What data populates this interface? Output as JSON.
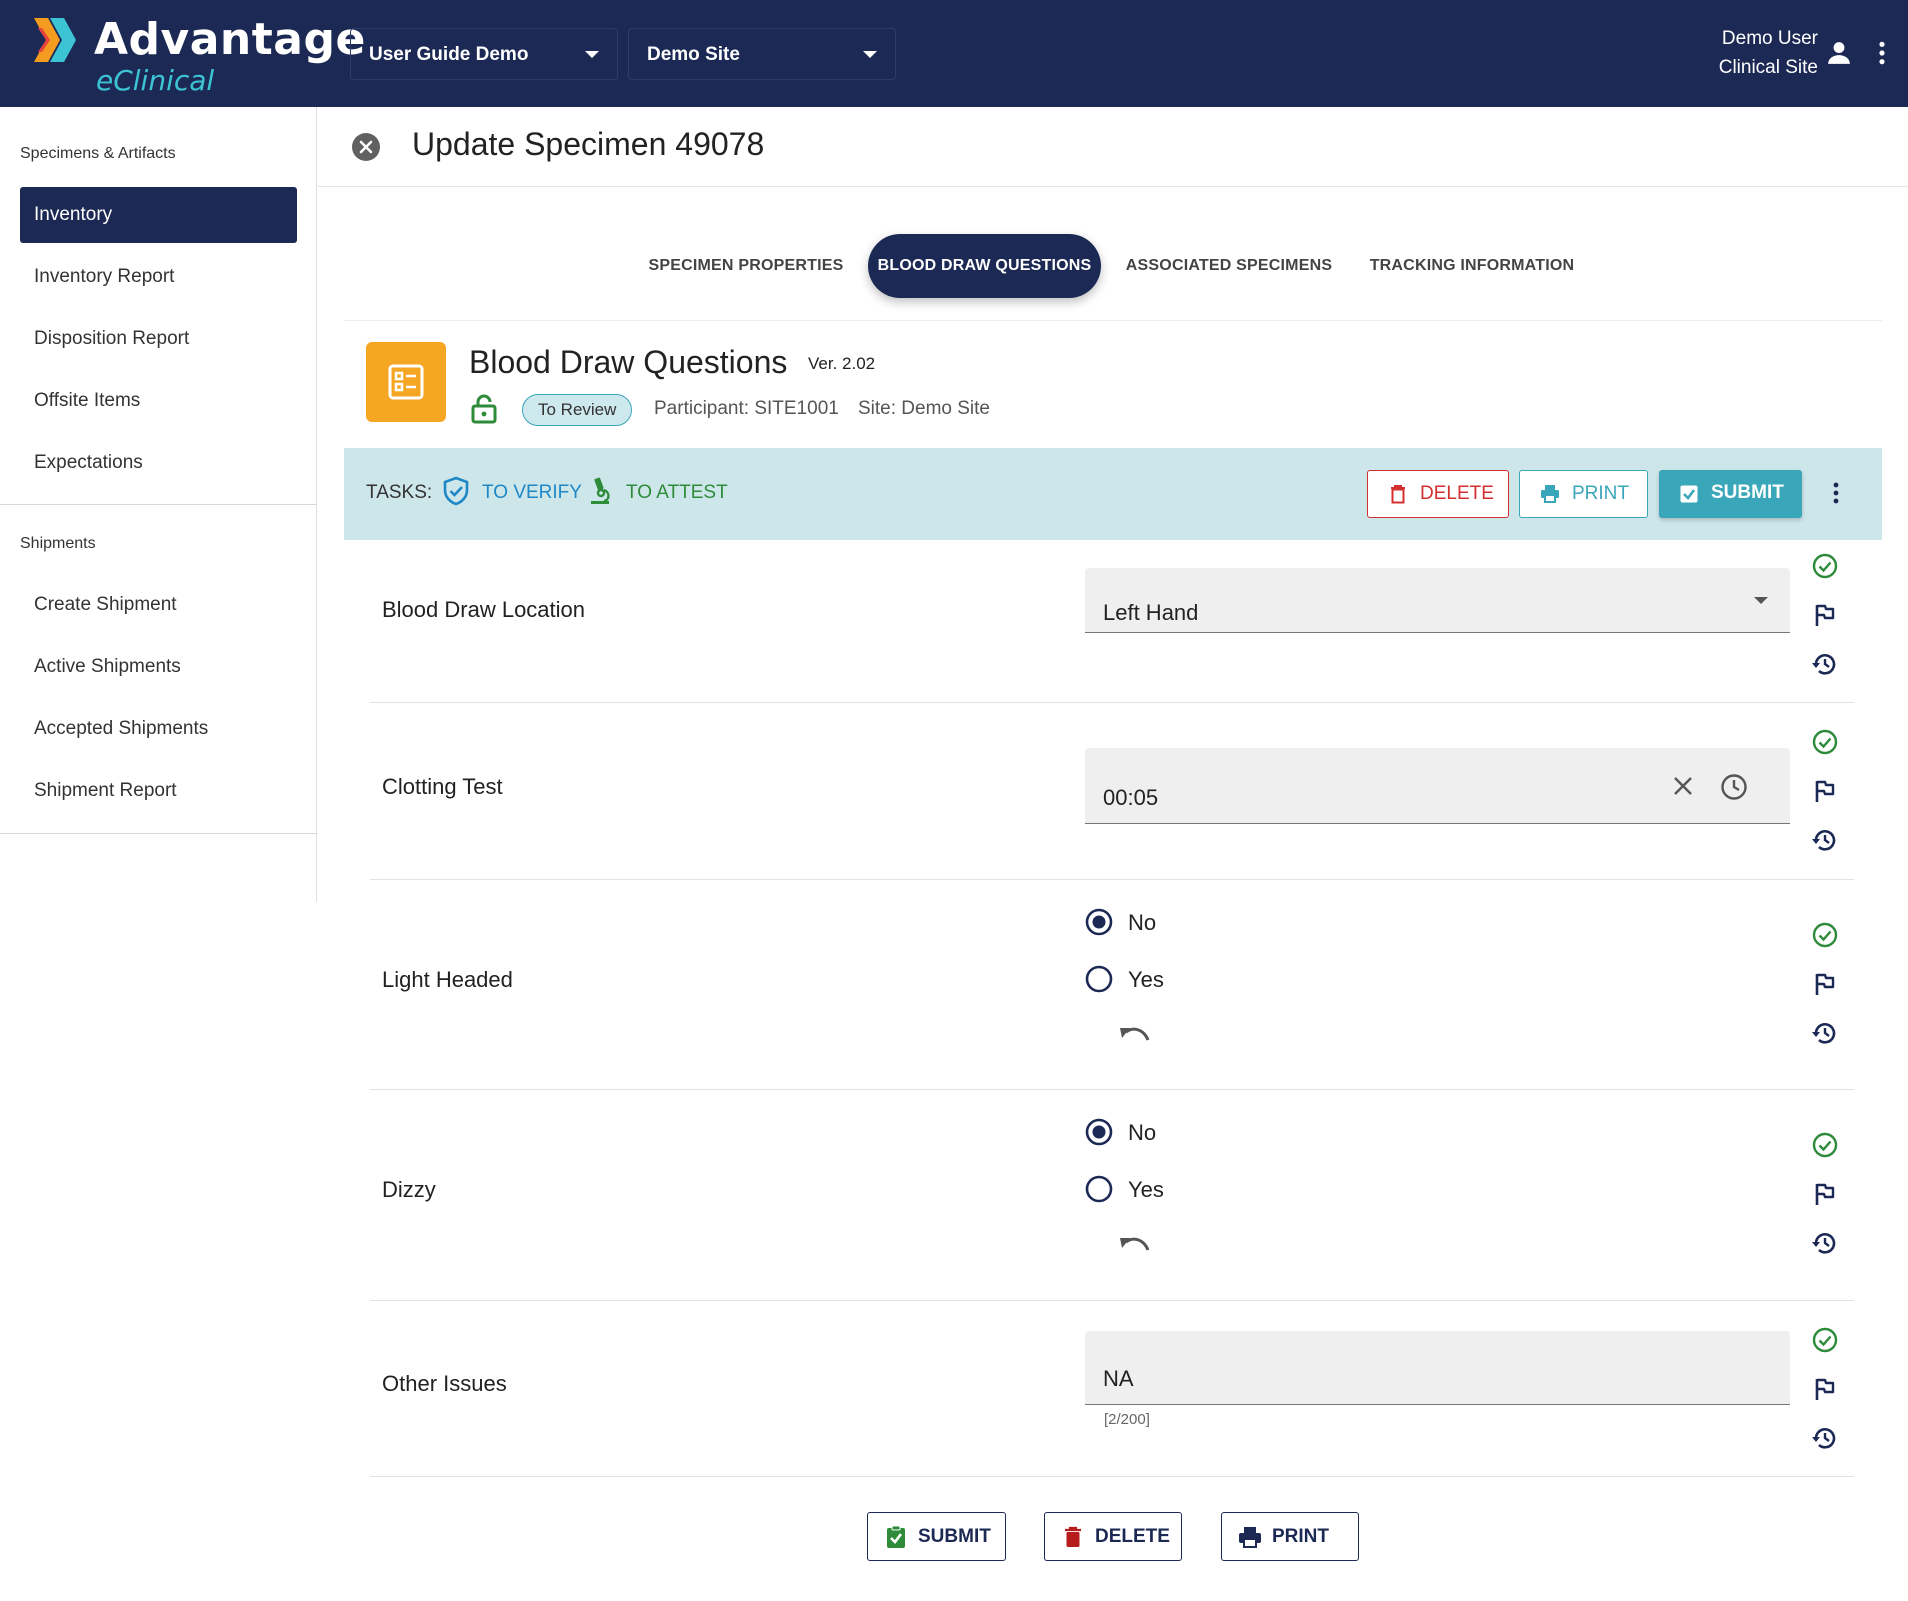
{
  "header": {
    "logo_main": "Advantage",
    "logo_sub": "eClinical",
    "study_select": "User Guide Demo",
    "site_select": "Demo Site",
    "user_name": "Demo User",
    "user_role": "Clinical Site"
  },
  "sidebar": {
    "section1": "Specimens & Artifacts",
    "items1": [
      "Inventory",
      "Inventory Report",
      "Disposition Report",
      "Offsite Items",
      "Expectations"
    ],
    "section2": "Shipments",
    "items2": [
      "Create Shipment",
      "Active Shipments",
      "Accepted Shipments",
      "Shipment Report"
    ],
    "active_item": "Inventory"
  },
  "page": {
    "title": "Update Specimen 49078"
  },
  "tabs": [
    "SPECIMEN PROPERTIES",
    "BLOOD DRAW QUESTIONS",
    "ASSOCIATED SPECIMENS",
    "TRACKING INFORMATION"
  ],
  "active_tab": "BLOOD DRAW QUESTIONS",
  "form": {
    "title": "Blood Draw Questions",
    "version": "Ver. 2.02",
    "status": "To Review",
    "participant": "Participant: SITE1001",
    "site": "Site: Demo Site"
  },
  "taskbar": {
    "label": "TASKS:",
    "verify": "TO VERIFY",
    "attest": "TO ATTEST",
    "delete": "DELETE",
    "print": "PRINT",
    "submit": "SUBMIT"
  },
  "questions": {
    "q1": {
      "label": "Blood Draw Location",
      "value": "Left Hand"
    },
    "q2": {
      "label": "Clotting Test",
      "value": "00:05"
    },
    "q3": {
      "label": "Light Headed",
      "options": [
        "No",
        "Yes"
      ],
      "selected": "No"
    },
    "q4": {
      "label": "Dizzy",
      "options": [
        "No",
        "Yes"
      ],
      "selected": "No"
    },
    "q5": {
      "label": "Other Issues",
      "value": "NA",
      "counter": "[2/200]"
    }
  },
  "bottom": {
    "submit": "SUBMIT",
    "delete": "DELETE",
    "print": "PRINT"
  },
  "colors": {
    "navy": "#1c2954",
    "accent_orange": "#f5a623",
    "teal": "#3aa6b9",
    "green": "#2e8b3a",
    "red": "#d32f2f",
    "verify_blue": "#1e88c7"
  },
  "icons": [
    "logo-chevron-icon",
    "user-icon",
    "more-vert-icon",
    "close-circle-icon",
    "form-list-icon",
    "unlock-icon",
    "shield-check-icon",
    "microscope-icon",
    "trash-icon",
    "printer-icon",
    "clipboard-check-icon",
    "check-circle-icon",
    "flag-icon",
    "history-icon",
    "clear-icon",
    "clock-icon",
    "undo-icon",
    "dropdown-caret-icon"
  ]
}
